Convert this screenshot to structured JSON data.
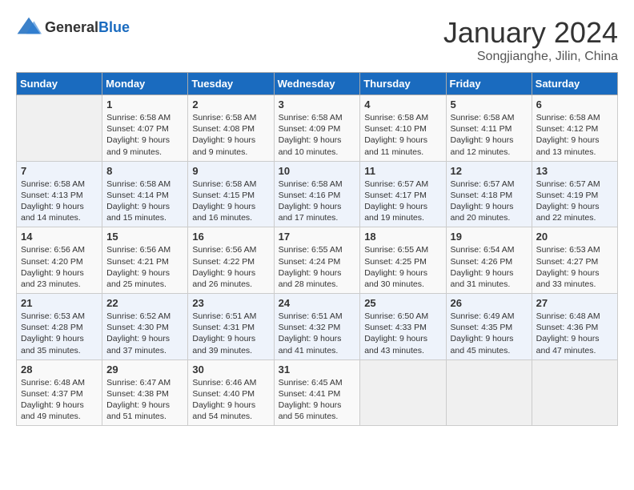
{
  "header": {
    "logo_general": "General",
    "logo_blue": "Blue",
    "month": "January 2024",
    "location": "Songjianghe, Jilin, China"
  },
  "weekdays": [
    "Sunday",
    "Monday",
    "Tuesday",
    "Wednesday",
    "Thursday",
    "Friday",
    "Saturday"
  ],
  "weeks": [
    [
      {
        "day": "",
        "empty": true
      },
      {
        "day": "1",
        "sunrise": "6:58 AM",
        "sunset": "4:07 PM",
        "daylight": "9 hours and 9 minutes."
      },
      {
        "day": "2",
        "sunrise": "6:58 AM",
        "sunset": "4:08 PM",
        "daylight": "9 hours and 9 minutes."
      },
      {
        "day": "3",
        "sunrise": "6:58 AM",
        "sunset": "4:09 PM",
        "daylight": "9 hours and 10 minutes."
      },
      {
        "day": "4",
        "sunrise": "6:58 AM",
        "sunset": "4:10 PM",
        "daylight": "9 hours and 11 minutes."
      },
      {
        "day": "5",
        "sunrise": "6:58 AM",
        "sunset": "4:11 PM",
        "daylight": "9 hours and 12 minutes."
      },
      {
        "day": "6",
        "sunrise": "6:58 AM",
        "sunset": "4:12 PM",
        "daylight": "9 hours and 13 minutes."
      }
    ],
    [
      {
        "day": "7",
        "sunrise": "6:58 AM",
        "sunset": "4:13 PM",
        "daylight": "9 hours and 14 minutes."
      },
      {
        "day": "8",
        "sunrise": "6:58 AM",
        "sunset": "4:14 PM",
        "daylight": "9 hours and 15 minutes."
      },
      {
        "day": "9",
        "sunrise": "6:58 AM",
        "sunset": "4:15 PM",
        "daylight": "9 hours and 16 minutes."
      },
      {
        "day": "10",
        "sunrise": "6:58 AM",
        "sunset": "4:16 PM",
        "daylight": "9 hours and 17 minutes."
      },
      {
        "day": "11",
        "sunrise": "6:57 AM",
        "sunset": "4:17 PM",
        "daylight": "9 hours and 19 minutes."
      },
      {
        "day": "12",
        "sunrise": "6:57 AM",
        "sunset": "4:18 PM",
        "daylight": "9 hours and 20 minutes."
      },
      {
        "day": "13",
        "sunrise": "6:57 AM",
        "sunset": "4:19 PM",
        "daylight": "9 hours and 22 minutes."
      }
    ],
    [
      {
        "day": "14",
        "sunrise": "6:56 AM",
        "sunset": "4:20 PM",
        "daylight": "9 hours and 23 minutes."
      },
      {
        "day": "15",
        "sunrise": "6:56 AM",
        "sunset": "4:21 PM",
        "daylight": "9 hours and 25 minutes."
      },
      {
        "day": "16",
        "sunrise": "6:56 AM",
        "sunset": "4:22 PM",
        "daylight": "9 hours and 26 minutes."
      },
      {
        "day": "17",
        "sunrise": "6:55 AM",
        "sunset": "4:24 PM",
        "daylight": "9 hours and 28 minutes."
      },
      {
        "day": "18",
        "sunrise": "6:55 AM",
        "sunset": "4:25 PM",
        "daylight": "9 hours and 30 minutes."
      },
      {
        "day": "19",
        "sunrise": "6:54 AM",
        "sunset": "4:26 PM",
        "daylight": "9 hours and 31 minutes."
      },
      {
        "day": "20",
        "sunrise": "6:53 AM",
        "sunset": "4:27 PM",
        "daylight": "9 hours and 33 minutes."
      }
    ],
    [
      {
        "day": "21",
        "sunrise": "6:53 AM",
        "sunset": "4:28 PM",
        "daylight": "9 hours and 35 minutes."
      },
      {
        "day": "22",
        "sunrise": "6:52 AM",
        "sunset": "4:30 PM",
        "daylight": "9 hours and 37 minutes."
      },
      {
        "day": "23",
        "sunrise": "6:51 AM",
        "sunset": "4:31 PM",
        "daylight": "9 hours and 39 minutes."
      },
      {
        "day": "24",
        "sunrise": "6:51 AM",
        "sunset": "4:32 PM",
        "daylight": "9 hours and 41 minutes."
      },
      {
        "day": "25",
        "sunrise": "6:50 AM",
        "sunset": "4:33 PM",
        "daylight": "9 hours and 43 minutes."
      },
      {
        "day": "26",
        "sunrise": "6:49 AM",
        "sunset": "4:35 PM",
        "daylight": "9 hours and 45 minutes."
      },
      {
        "day": "27",
        "sunrise": "6:48 AM",
        "sunset": "4:36 PM",
        "daylight": "9 hours and 47 minutes."
      }
    ],
    [
      {
        "day": "28",
        "sunrise": "6:48 AM",
        "sunset": "4:37 PM",
        "daylight": "9 hours and 49 minutes."
      },
      {
        "day": "29",
        "sunrise": "6:47 AM",
        "sunset": "4:38 PM",
        "daylight": "9 hours and 51 minutes."
      },
      {
        "day": "30",
        "sunrise": "6:46 AM",
        "sunset": "4:40 PM",
        "daylight": "9 hours and 54 minutes."
      },
      {
        "day": "31",
        "sunrise": "6:45 AM",
        "sunset": "4:41 PM",
        "daylight": "9 hours and 56 minutes."
      },
      {
        "day": "",
        "empty": true
      },
      {
        "day": "",
        "empty": true
      },
      {
        "day": "",
        "empty": true
      }
    ]
  ]
}
